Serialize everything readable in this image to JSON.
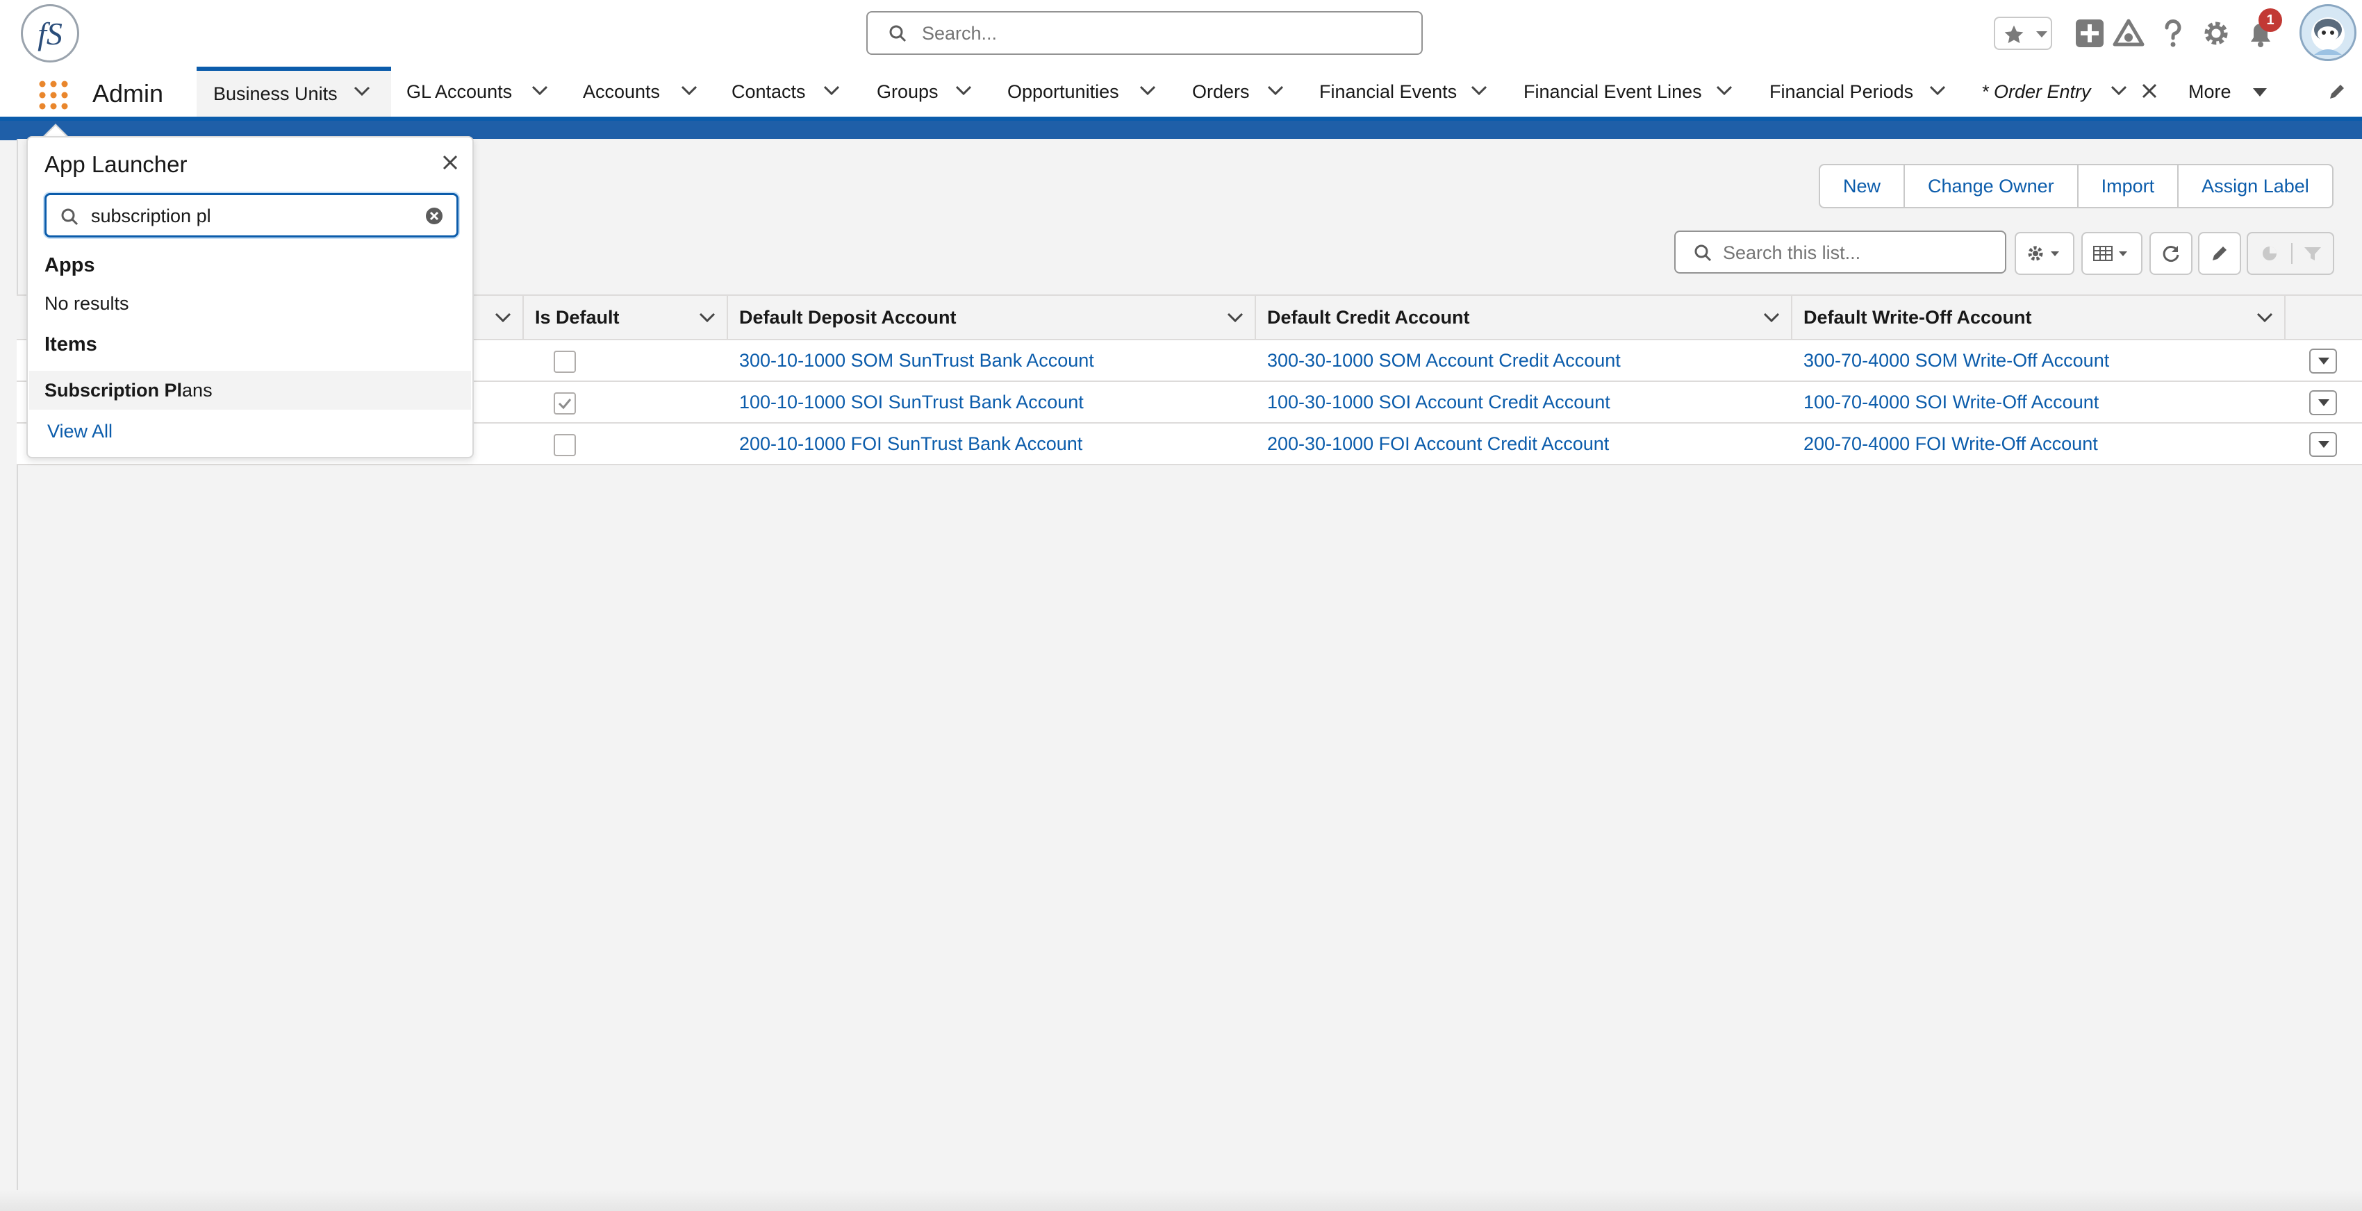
{
  "header": {
    "logo_text": "fS",
    "search_placeholder": "Search...",
    "notification_count": "1"
  },
  "nav": {
    "app_name": "Admin",
    "tabs": [
      {
        "label": "Business Units"
      },
      {
        "label": "GL Accounts"
      },
      {
        "label": "Accounts"
      },
      {
        "label": "Contacts"
      },
      {
        "label": "Groups"
      },
      {
        "label": "Opportunities"
      },
      {
        "label": "Orders"
      },
      {
        "label": "Financial Events"
      },
      {
        "label": "Financial Event Lines"
      },
      {
        "label": "Financial Periods"
      },
      {
        "label": "* Order Entry"
      },
      {
        "label": "More"
      }
    ]
  },
  "actions": {
    "new": "New",
    "change_owner": "Change Owner",
    "import": "Import",
    "assign_label": "Assign Label"
  },
  "list": {
    "search_placeholder": "Search this list...",
    "columns": [
      "Is Default",
      "Default Deposit Account",
      "Default Credit Account",
      "Default Write-Off Account"
    ],
    "rows": [
      {
        "is_default": false,
        "deposit": "300-10-1000 SOM SunTrust Bank Account",
        "credit": "300-30-1000 SOM Account Credit Account",
        "writeoff": "300-70-4000 SOM Write-Off Account"
      },
      {
        "is_default": true,
        "deposit": "100-10-1000 SOI SunTrust Bank Account",
        "credit": "100-30-1000 SOI Account Credit Account",
        "writeoff": "100-70-4000 SOI Write-Off Account"
      },
      {
        "is_default": false,
        "deposit": "200-10-1000 FOI SunTrust Bank Account",
        "credit": "200-30-1000 FOI Account Credit Account",
        "writeoff": "200-70-4000 FOI Write-Off Account"
      }
    ]
  },
  "launcher": {
    "title": "App Launcher",
    "search_value": "subscription pl",
    "apps_heading": "Apps",
    "apps_empty": "No results",
    "items_heading": "Items",
    "item_match": "Subscription Pl",
    "item_rest": "ans",
    "view_all": "View All"
  },
  "colors": {
    "brand_blue": "#0b5cab",
    "band_blue": "#1f5fa8",
    "badge_red": "#c23934"
  }
}
